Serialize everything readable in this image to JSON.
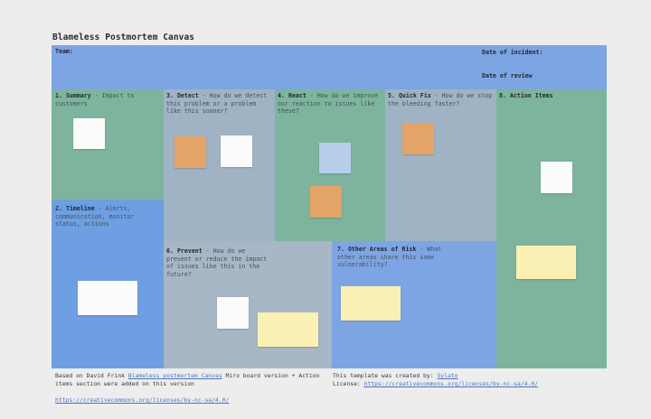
{
  "title": "Blameless Postmortem Canvas",
  "header": {
    "team_label": "Team:",
    "date_incident_label": "Date of incident:",
    "date_review_label": "Date of review"
  },
  "sections": {
    "summary": {
      "number": "1.",
      "title": "Summary",
      "desc": " - Impact to customers"
    },
    "detect": {
      "number": "3.",
      "title": "Detect",
      "desc": " - How do we detect this problem or a problem like this sooner?"
    },
    "react": {
      "number": "4.",
      "title": "React",
      "desc": " - How do we improve our reaction to issues like these?"
    },
    "quickfix": {
      "number": "5.",
      "title": "Quick Fix",
      "desc": " - How do we stop the bleeding faster?"
    },
    "actions": {
      "number": "8.",
      "title": "Action Items",
      "desc": ""
    },
    "timeline": {
      "number": "2.",
      "title": "Timeline",
      "desc": " - Alerts, communication, monitor status, actions"
    },
    "prevent": {
      "number": "6.",
      "title": "Prevent",
      "desc": " - How do we prevent or reduce the impact of issues like this in the future?"
    },
    "risk": {
      "number": "7.",
      "title": "Other Areas of Risk",
      "desc": " - What other areas share this same vulnerability?"
    }
  },
  "footer": {
    "based_prefix": "Based on David Frink ",
    "based_link": "Blameless postmortem Canvas",
    "based_suffix": " Miro board version + Action items section were added on this version",
    "license_url": "https://creativecommons.org/licenses/by-nc-sa/4.0/",
    "created_prefix": "This template was created by: ",
    "created_by": "Sylato",
    "license_prefix": "License: ",
    "license_link": "https://creativecommons.org/licenses/by-nc-sa/4.0/"
  },
  "colors": {
    "header": "#7ea5e3",
    "green": "#7eb49d",
    "slate": "#9fb3c4",
    "blue": "#6d9fe2",
    "sticky_orange": "#e5a467",
    "sticky_yellow": "#fbf0b3",
    "sticky_blue": "#b6cdec"
  }
}
